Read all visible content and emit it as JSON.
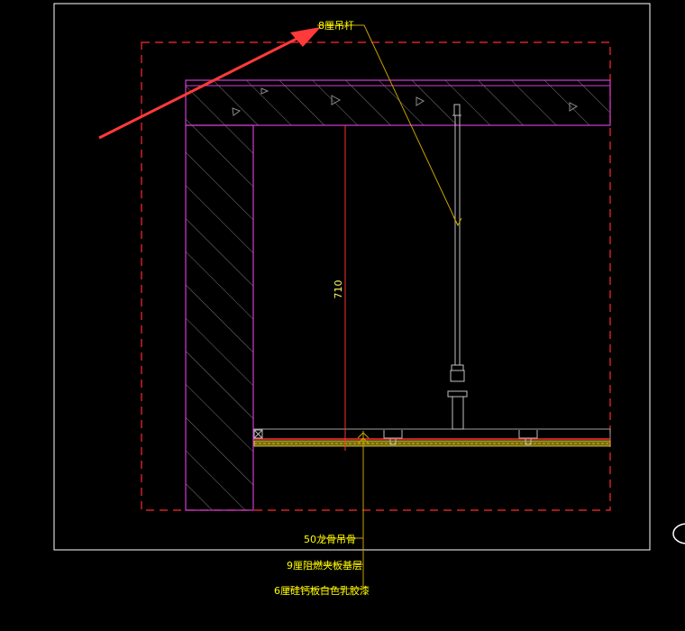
{
  "drawing": {
    "labels": {
      "hanger_rod": "8厘吊杆",
      "dimension_height": "710",
      "keel": "50龙骨吊骨",
      "plywood_base": "9厘阻燃夹板基层",
      "gypsum_board": "6厘硅钙板白色乳胶漆"
    }
  },
  "colors": {
    "background": "#000000",
    "frame": "#ffffff",
    "boundary": "#ff2a2a",
    "wall": "#d23cd2",
    "leader": "#c8a000",
    "label_text": "#ffff00",
    "dimension": "#ff3030",
    "hanger": "#c0c0c0",
    "arrow": "#ff3a3a"
  }
}
